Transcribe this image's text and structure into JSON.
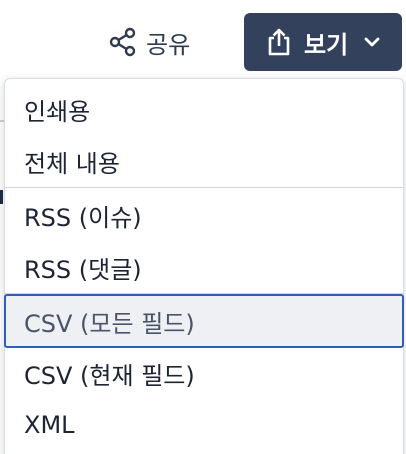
{
  "toolbar": {
    "share_label": "공유",
    "share_icon": "share-icon",
    "view_label": "보기",
    "view_icon": "upload-icon",
    "view_chevron_icon": "chevron-down-icon",
    "view_button_color": "#33415c"
  },
  "menu": {
    "items": [
      {
        "label": "인쇄용",
        "section": 1
      },
      {
        "label": "전체 내용",
        "section": 1
      },
      {
        "label": "RSS (이슈)",
        "section": 2
      },
      {
        "label": "RSS (댓글)",
        "section": 2
      },
      {
        "label": "CSV (모든 필드)",
        "section": 3,
        "state": "focused"
      },
      {
        "label": "CSV (현재 필드)",
        "section": 3
      },
      {
        "label": "XML",
        "section": 3
      }
    ],
    "focus_color": "#2f5fb8"
  }
}
